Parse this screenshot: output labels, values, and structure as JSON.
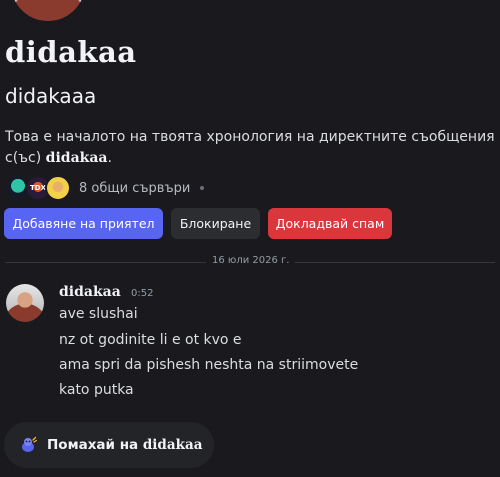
{
  "profile": {
    "display_name": "didakaa",
    "username": "didakaaa",
    "intro_prefix": "Това е началото на твоята хронология на директните съобщения с(ъс) ",
    "intro_name": "didakaa",
    "intro_suffix": ".",
    "mutual_servers": "8 общи сървъри",
    "server_icon_2_label": "TDX"
  },
  "actions": {
    "add_friend": "Добавяне на приятел",
    "block": "Блокиране",
    "report_spam": "Докладвай спам"
  },
  "divider": {
    "date": "16 юли 2026 г."
  },
  "message": {
    "author": "didakaa",
    "time": "0:52",
    "lines": [
      "ave slushai",
      "nz ot godinite li e ot kvo e",
      "ama spri da pishesh neshta na striimovete",
      "kato putka"
    ]
  },
  "wave": {
    "prefix": "Помахай на ",
    "name": "didakaa"
  },
  "colors": {
    "background": "#1a1a1e",
    "primary_button": "#5865f2",
    "danger_button": "#da373c",
    "secondary_button": "#2b2d31"
  },
  "icons": {
    "wave": "waving-wumpus-icon",
    "separator": "dot-icon"
  }
}
